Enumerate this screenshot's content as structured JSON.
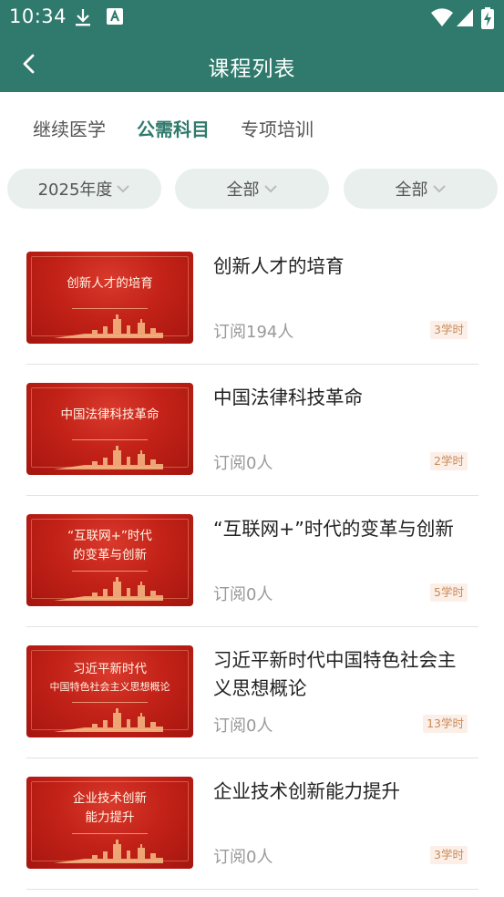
{
  "status_bar": {
    "time": "10:34"
  },
  "header": {
    "title": "课程列表"
  },
  "tabs": [
    {
      "label": "继续医学",
      "active": false
    },
    {
      "label": "公需科目",
      "active": true
    },
    {
      "label": "专项培训",
      "active": false
    }
  ],
  "filters": [
    {
      "label": "2025年度"
    },
    {
      "label": "全部"
    },
    {
      "label": "全部"
    }
  ],
  "courses": [
    {
      "thumb_lines": [
        "创新人才的培育"
      ],
      "title": "创新人才的培育",
      "subs": "订阅194人",
      "hours": "3学时"
    },
    {
      "thumb_lines": [
        "中国法律科技革命"
      ],
      "title": "中国法律科技革命",
      "subs": "订阅0人",
      "hours": "2学时"
    },
    {
      "thumb_lines": [
        "“互联网+”时代",
        "的变革与创新"
      ],
      "title": "“互联网+”时代的变革与创新",
      "subs": "订阅0人",
      "hours": "5学时"
    },
    {
      "thumb_lines": [
        "习近平新时代",
        "中国特色社会主义思想概论"
      ],
      "title": "习近平新时代中国特色社会主义思想概论",
      "subs": "订阅0人",
      "hours": "13学时"
    },
    {
      "thumb_lines": [
        "企业技术创新",
        "能力提升"
      ],
      "title": "企业技术创新能力提升",
      "subs": "订阅0人",
      "hours": "3学时"
    }
  ],
  "colors": {
    "primary": "#2f7a6c",
    "pill_bg": "#e8efed",
    "badge_bg": "#fbefe7",
    "badge_text": "#c98a5a"
  }
}
